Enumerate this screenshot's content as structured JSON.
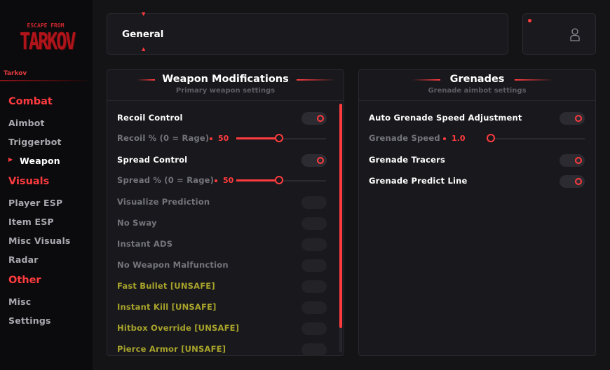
{
  "logo": {
    "line1": "ESCAPE FROM",
    "line2": "TARKOV"
  },
  "app_name": "Tarkov",
  "sidebar": {
    "sections": [
      {
        "label": "Combat",
        "items": [
          "Aimbot",
          "Triggerbot",
          "Weapon"
        ]
      },
      {
        "label": "Visuals",
        "items": [
          "Player ESP",
          "Item ESP",
          "Misc Visuals",
          "Radar"
        ]
      },
      {
        "label": "Other",
        "items": [
          "Misc",
          "Settings"
        ]
      }
    ],
    "active_item": "Weapon"
  },
  "header": {
    "title": "General"
  },
  "weapon_panel": {
    "title": "Weapon Modifications",
    "subtitle": "Primary weapon settings",
    "rows": [
      {
        "label": "Recoil Control",
        "type": "toggle",
        "on": true
      },
      {
        "label": "Recoil % (0 = Rage)",
        "type": "slider",
        "value": "50",
        "fraction": 0.5
      },
      {
        "label": "Spread Control",
        "type": "toggle",
        "on": true
      },
      {
        "label": "Spread % (0 = Rage)",
        "type": "slider",
        "value": "50",
        "fraction": 0.5
      },
      {
        "label": "Visualize Prediction",
        "type": "toggle",
        "on": false
      },
      {
        "label": "No Sway",
        "type": "toggle",
        "on": false
      },
      {
        "label": "Instant ADS",
        "type": "toggle",
        "on": false
      },
      {
        "label": "No Weapon Malfunction",
        "type": "toggle",
        "on": false
      },
      {
        "label": "Fast Bullet [UNSAFE]",
        "type": "toggle",
        "on": false,
        "unsafe": true
      },
      {
        "label": "Instant Kill [UNSAFE]",
        "type": "toggle",
        "on": false,
        "unsafe": true
      },
      {
        "label": "Hitbox Override [UNSAFE]",
        "type": "toggle",
        "on": false,
        "unsafe": true
      },
      {
        "label": "Pierce Armor [UNSAFE]",
        "type": "toggle",
        "on": false,
        "unsafe": true
      }
    ]
  },
  "grenade_panel": {
    "title": "Grenades",
    "subtitle": "Grenade aimbot settings",
    "rows": [
      {
        "label": "Auto Grenade Speed Adjustment",
        "type": "toggle",
        "on": true
      },
      {
        "label": "Grenade Speed",
        "type": "slider",
        "value": "1.0",
        "fraction": 0.0
      },
      {
        "label": "Grenade Tracers",
        "type": "toggle",
        "on": true
      },
      {
        "label": "Grenade Predict Line",
        "type": "toggle",
        "on": true
      }
    ]
  },
  "colors": {
    "accent": "#ff3b3f",
    "unsafe": "#a8a32b",
    "background": "#141417",
    "sidebar": "#0b0b0d"
  },
  "icons": {
    "user": "user-icon",
    "nav_active": "triangle-right-icon",
    "header_arrows": "triangle-up-down-icon"
  }
}
